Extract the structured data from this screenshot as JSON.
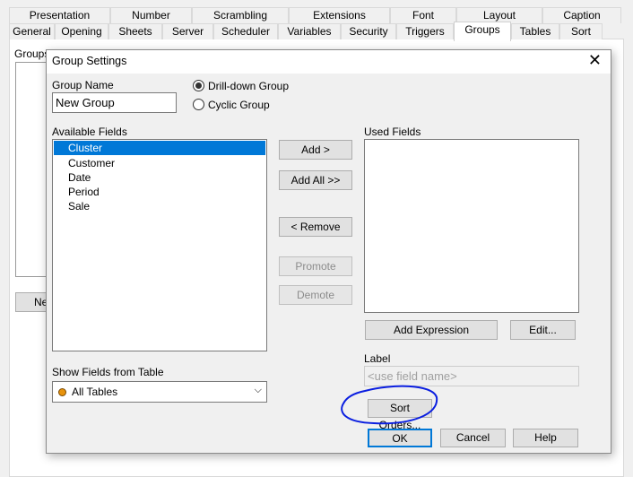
{
  "tabs_row1": [
    "Presentation",
    "Number",
    "Scrambling",
    "Extensions",
    "Font",
    "Layout",
    "Caption"
  ],
  "tabs_row2": [
    "General",
    "Opening",
    "Sheets",
    "Server",
    "Scheduler",
    "Variables",
    "Security",
    "Triggers",
    "Groups",
    "Tables",
    "Sort"
  ],
  "active_tab": "Groups",
  "background": {
    "groups_label": "Groups",
    "new_button": "Ne"
  },
  "dialog": {
    "title": "Group Settings",
    "group_name_label": "Group Name",
    "group_name_value": "New Group",
    "radio_drilldown": "Drill-down Group",
    "radio_cyclic": "Cyclic Group",
    "selected_radio": "Drill-down Group",
    "available_label": "Available Fields",
    "available_fields": [
      "Cluster",
      "Customer",
      "Date",
      "Period",
      "Sale"
    ],
    "selected_field": "Cluster",
    "used_label": "Used Fields",
    "add": "Add >",
    "add_all": "Add All >>",
    "remove": "< Remove",
    "promote": "Promote",
    "demote": "Demote",
    "add_expression": "Add Expression",
    "edit": "Edit...",
    "label_label": "Label",
    "label_placeholder": "<use field name>",
    "show_fields_label": "Show Fields from Table",
    "show_fields_value": "All Tables",
    "sort_orders": "Sort Orders...",
    "ok": "OK",
    "cancel": "Cancel",
    "help": "Help"
  },
  "colors": {
    "selection": "#0078d7",
    "annotation": "#0a1ee0",
    "table_dot": "#e8930c"
  }
}
